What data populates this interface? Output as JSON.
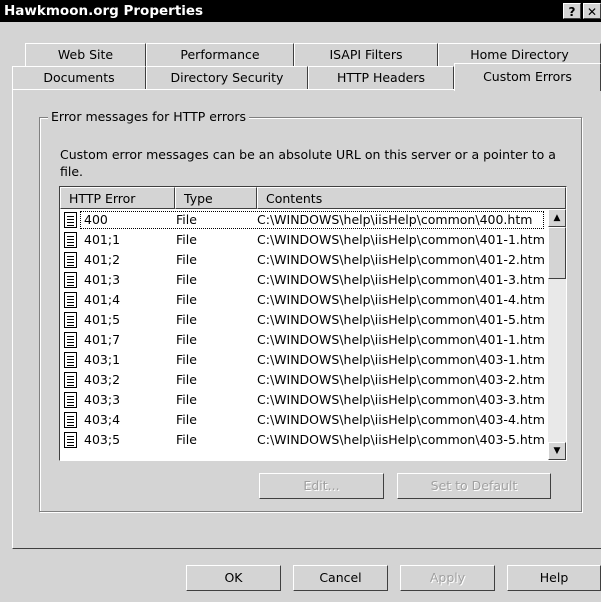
{
  "window": {
    "title": "Hawkmoon.org Properties",
    "help_button": "?",
    "close_button": "✕"
  },
  "tabs_back": [
    "Web Site",
    "Performance",
    "ISAPI Filters",
    "Home Directory"
  ],
  "tabs_front": [
    "Documents",
    "Directory Security",
    "HTTP Headers",
    "Custom Errors"
  ],
  "active_tab": "Custom Errors",
  "group": {
    "label": "Error messages for HTTP errors",
    "description": "Custom error messages can be an absolute URL on this server or a pointer to a file."
  },
  "list": {
    "columns": [
      "HTTP Error",
      "Type",
      "Contents"
    ],
    "rows": [
      {
        "error": "400",
        "type": "File",
        "contents": "C:\\WINDOWS\\help\\iisHelp\\common\\400.htm"
      },
      {
        "error": "401;1",
        "type": "File",
        "contents": "C:\\WINDOWS\\help\\iisHelp\\common\\401-1.htm"
      },
      {
        "error": "401;2",
        "type": "File",
        "contents": "C:\\WINDOWS\\help\\iisHelp\\common\\401-2.htm"
      },
      {
        "error": "401;3",
        "type": "File",
        "contents": "C:\\WINDOWS\\help\\iisHelp\\common\\401-3.htm"
      },
      {
        "error": "401;4",
        "type": "File",
        "contents": "C:\\WINDOWS\\help\\iisHelp\\common\\401-4.htm"
      },
      {
        "error": "401;5",
        "type": "File",
        "contents": "C:\\WINDOWS\\help\\iisHelp\\common\\401-5.htm"
      },
      {
        "error": "401;7",
        "type": "File",
        "contents": "C:\\WINDOWS\\help\\iisHelp\\common\\401-1.htm"
      },
      {
        "error": "403;1",
        "type": "File",
        "contents": "C:\\WINDOWS\\help\\iisHelp\\common\\403-1.htm"
      },
      {
        "error": "403;2",
        "type": "File",
        "contents": "C:\\WINDOWS\\help\\iisHelp\\common\\403-2.htm"
      },
      {
        "error": "403;3",
        "type": "File",
        "contents": "C:\\WINDOWS\\help\\iisHelp\\common\\403-3.htm"
      },
      {
        "error": "403;4",
        "type": "File",
        "contents": "C:\\WINDOWS\\help\\iisHelp\\common\\403-4.htm"
      },
      {
        "error": "403;5",
        "type": "File",
        "contents": "C:\\WINDOWS\\help\\iisHelp\\common\\403-5.htm"
      }
    ],
    "row_icon": "document-icon",
    "scroll_up": "▲",
    "scroll_down": "▼"
  },
  "edit_button": "Edit...",
  "set_default_button": "Set to Default",
  "footer": {
    "ok": "OK",
    "cancel": "Cancel",
    "apply": "Apply",
    "help": "Help"
  }
}
